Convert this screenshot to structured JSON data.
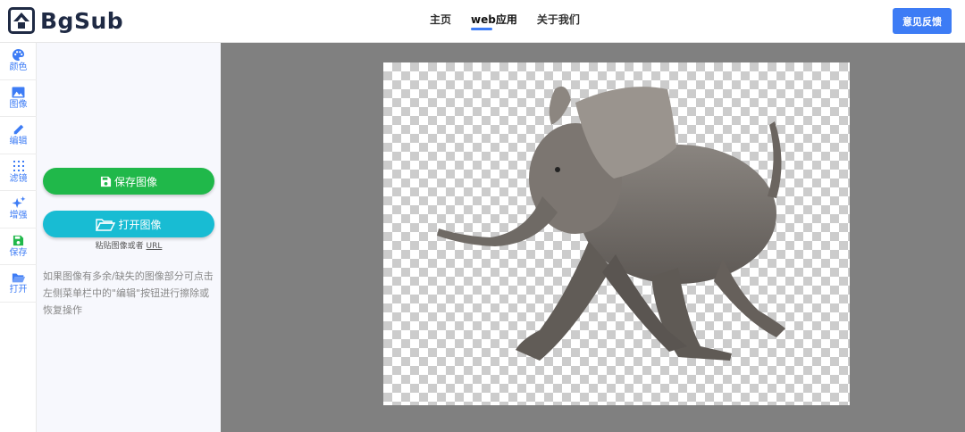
{
  "app": {
    "name": "BgSub"
  },
  "nav": {
    "items": [
      {
        "label": "主页"
      },
      {
        "label": "web应用"
      },
      {
        "label": "关于我们"
      }
    ]
  },
  "header": {
    "feedback_label": "意见反馈"
  },
  "sidebar": {
    "items": [
      {
        "label": "颜色",
        "icon": "palette-icon"
      },
      {
        "label": "图像",
        "icon": "image-icon"
      },
      {
        "label": "编辑",
        "icon": "pencil-icon"
      },
      {
        "label": "滤镜",
        "icon": "filter-grid-icon"
      },
      {
        "label": "增强",
        "icon": "sparkle-icon"
      },
      {
        "label": "保存",
        "icon": "save-icon"
      },
      {
        "label": "打开",
        "icon": "folder-open-icon"
      }
    ]
  },
  "panel": {
    "save_label": "保存图像",
    "open_label": "打开图像",
    "paste_hint": "粘贴图像或者",
    "paste_url": "URL",
    "info": "如果图像有多余/缺失的图像部分可点击左侧菜单栏中的\"编辑\"按钮进行擦除或恢复操作"
  },
  "colors": {
    "accent": "#3d7cf5",
    "save": "#20b84a",
    "open": "#18bcd3",
    "canvas_bg": "#808080"
  }
}
